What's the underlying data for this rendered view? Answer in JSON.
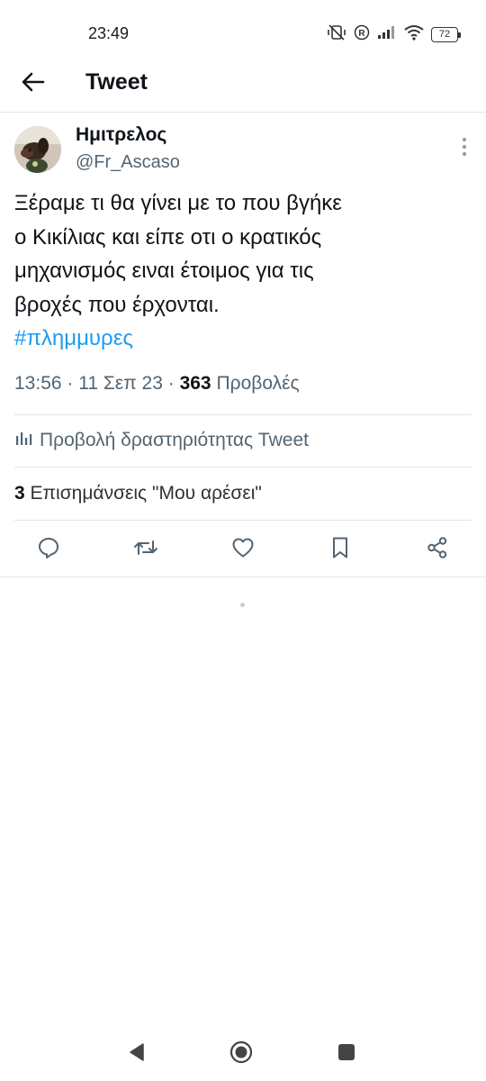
{
  "status_bar": {
    "time": "23:49",
    "battery": "72",
    "icons": [
      "mute-vibrate-icon",
      "registered-icon",
      "signal-icon",
      "wifi-icon",
      "battery-icon"
    ]
  },
  "header": {
    "title": "Tweet",
    "back_icon": "arrow-left-icon"
  },
  "tweet": {
    "author": {
      "display_name": "Ημιτρελος",
      "handle": "@Fr_Ascaso"
    },
    "text_lines": [
      "Ξέραμε τι θα γίνει με το που βγήκε",
      "ο Κικίλιας και είπε οτι ο κρατικός",
      "μηχανισμός ειναι έτοιμος για τις",
      "βροχές που έρχονται."
    ],
    "hashtag": "#πλημμυρες",
    "meta": {
      "time": "13:56",
      "date": "11 Σεπ 23",
      "views_count": "363",
      "views_label": "Προβολές"
    },
    "activity_label": "Προβολή δραστηριότητας Tweet",
    "likes": {
      "count": "3",
      "label": "Επισημάνσεις \"Μου αρέσει\""
    }
  },
  "actions": [
    "reply-icon",
    "retweet-icon",
    "like-icon",
    "bookmark-icon",
    "share-icon"
  ],
  "colors": {
    "accent": "#1d9bf0",
    "text_primary": "#0f1419",
    "text_secondary": "#536471",
    "divider": "#e6e6e6"
  }
}
